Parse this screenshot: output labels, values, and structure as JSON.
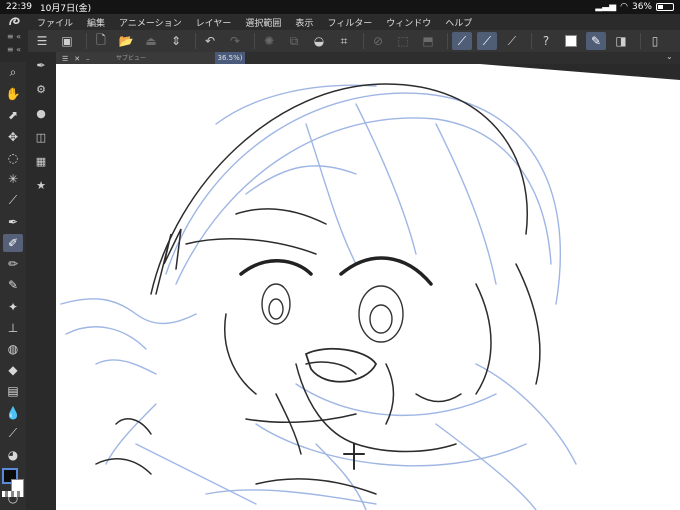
{
  "status": {
    "time": "22:39",
    "date": "10月7日(金)",
    "battery": "36%",
    "battery_level": 0.36
  },
  "menu": [
    "ファイル",
    "編集",
    "アニメーション",
    "レイヤー",
    "選択範囲",
    "表示",
    "フィルター",
    "ウィンドウ",
    "ヘルプ"
  ],
  "subview": {
    "label": "サブビュー"
  },
  "canvas": {
    "zoom_partial": "36.5%)"
  },
  "colors": {
    "main": "#0b0b0b",
    "sub": "#ffffff",
    "line_blue": "#7f9fd6",
    "line_dark": "#2c2c2c"
  }
}
